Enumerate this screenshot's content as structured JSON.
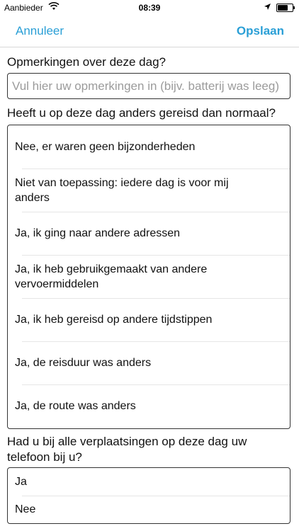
{
  "status_bar": {
    "carrier": "Aanbieder",
    "time": "08:39"
  },
  "nav": {
    "cancel": "Annuleer",
    "save": "Opslaan"
  },
  "comments": {
    "label": "Opmerkingen over deze dag?",
    "placeholder": "Vul hier uw opmerkingen in (bijv. batterij was leeg)",
    "value": ""
  },
  "travel_question": {
    "label": "Heeft u op deze dag anders gereisd dan normaal?",
    "options": [
      "Nee, er waren geen bijzonderheden",
      "Niet van toepassing: iedere dag is voor mij anders",
      "Ja, ik ging naar andere adressen",
      "Ja, ik heb gebruikgemaakt van andere vervoermiddelen",
      "Ja, ik heb gereisd op andere tijdstippen",
      "Ja, de reisduur was anders",
      "Ja, de route was anders"
    ]
  },
  "phone_question": {
    "label": "Had u bij alle verplaatsingen op deze dag uw telefoon bij u?",
    "options": [
      "Ja",
      "Nee"
    ]
  }
}
